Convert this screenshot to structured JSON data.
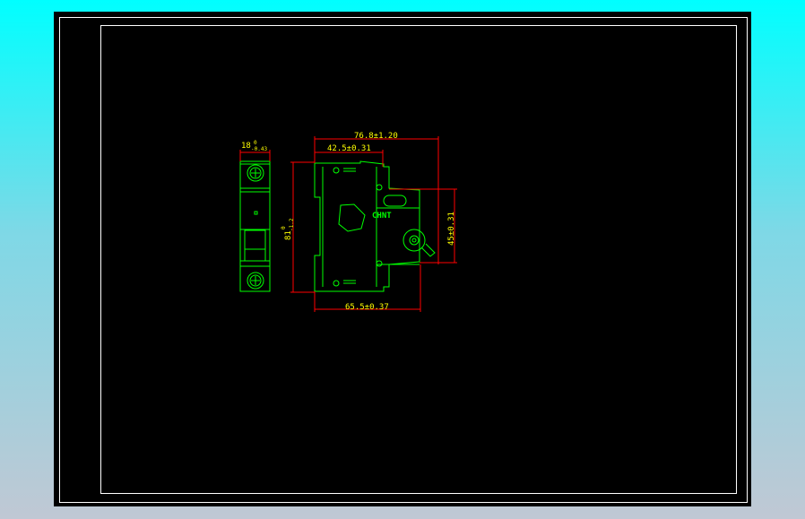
{
  "drawing": {
    "dimensions": {
      "overall_length": "76.8±1.20",
      "mount_offset": "42.5±0.31",
      "width": "18",
      "width_tol_upper": "0",
      "width_tol_lower": "-0.43",
      "height": "81",
      "height_tol_upper": "0",
      "height_tol_lower": "-1.2",
      "base_length": "65.5±0.37",
      "handle_height": "45±0.31"
    },
    "brand_label": "CHNT",
    "colors": {
      "outline": "#00ff00",
      "dimension": "#ff0000",
      "text": "#ffff00",
      "frame": "#ffffff",
      "paper": "#000000"
    }
  }
}
